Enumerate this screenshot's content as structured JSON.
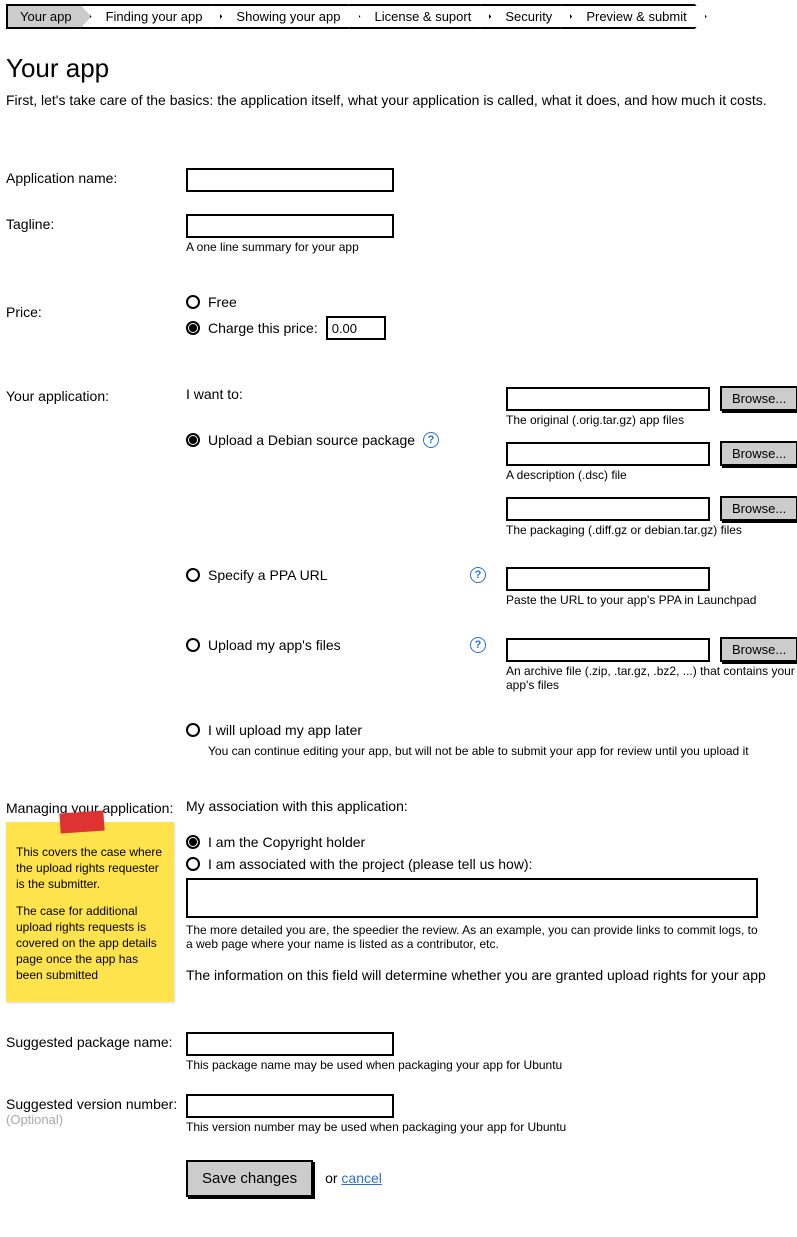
{
  "steps": [
    "Your app",
    "Finding your app",
    "Showing your app",
    "License & suport",
    "Security",
    "Preview & submit"
  ],
  "active_step_index": 0,
  "page_title": "Your app",
  "intro": "First, let's take care of the basics: the application itself, what your application is called, what it does, and how much it costs.",
  "labels": {
    "app_name": "Application name:",
    "tagline": "Tagline:",
    "price": "Price:",
    "your_application": "Your application:",
    "managing": "Managing your application:",
    "suggested_pkg": "Suggested package name:",
    "suggested_ver": "Suggested version number:",
    "optional": "(Optional)"
  },
  "hints": {
    "tagline": "A one line summary for your app",
    "pkg": "This package name may be used when packaging your app for Ubuntu",
    "ver": "This version number may be used when packaging your app for Ubuntu"
  },
  "price": {
    "free_label": "Free",
    "charge_label": "Charge this price:",
    "value": "0.00",
    "selected": "charge"
  },
  "your_app": {
    "i_want_to": "I want to:",
    "options": {
      "debian": "Upload a Debian source package",
      "ppa": "Specify a PPA URL",
      "files": "Upload my app's files",
      "later": "I will upload my app later"
    },
    "later_hint": "You can continue editing your app, but will not be able to submit your app for review until you upload it",
    "selected": "debian",
    "uploads": {
      "orig": "The original (.orig.tar.gz) app files",
      "dsc": "A description (.dsc) file",
      "diff": "The packaging (.diff.gz or debian.tar.gz) files",
      "ppa": "Paste the URL to your app's PPA in Launchpad",
      "archive": "An archive file (.zip, .tar.gz, .bz2, ...) that contains your app's files"
    },
    "browse": "Browse..."
  },
  "managing": {
    "heading": "My association with this application:",
    "copyright": "I am the Copyright holder",
    "associated": "I am associated with the project (please tell us how):",
    "selected": "copyright",
    "hint": "The more detailed you are, the speedier the review. As an example, you can provide links to commit logs, to a web page where your name is listed as a contributor, etc.",
    "info": "The information on this field will determine whether you are granted upload rights for your app"
  },
  "sticky": {
    "p1": "This covers the case where the upload rights requester is the submitter.",
    "p2": "The case for additional upload rights requests is covered on the app details page once the app has been submitted"
  },
  "actions": {
    "save": "Save changes",
    "or": "or",
    "cancel": "cancel"
  }
}
